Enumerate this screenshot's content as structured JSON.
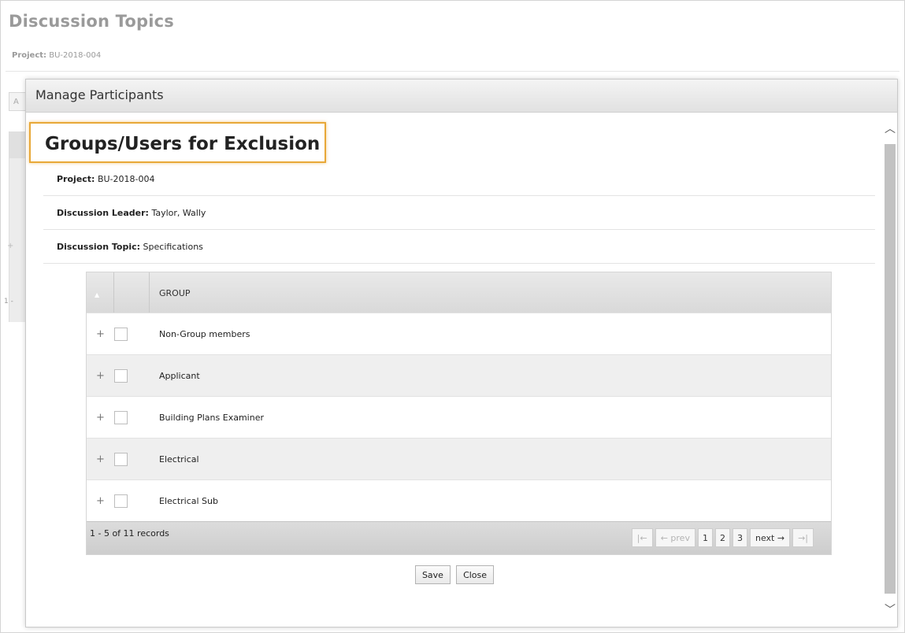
{
  "background": {
    "title": "Discussion Topics",
    "project_label": "Project:",
    "project_value": "BU-2018-004",
    "stub_text": "1 -",
    "close_label": "×"
  },
  "modal": {
    "title": "Manage Participants",
    "section_title": "Groups/Users for Exclusion",
    "info": [
      {
        "label": "Project:",
        "value": "BU-2018-004"
      },
      {
        "label": "Discussion Leader:",
        "value": "Taylor, Wally"
      },
      {
        "label": "Discussion Topic:",
        "value": "Specifications"
      }
    ],
    "grid": {
      "column_header": "GROUP",
      "rows": [
        {
          "expand": "+",
          "name": "Non-Group members"
        },
        {
          "expand": "+",
          "name": "Applicant"
        },
        {
          "expand": "+",
          "name": "Building Plans Examiner"
        },
        {
          "expand": "+",
          "name": "Electrical"
        },
        {
          "expand": "+",
          "name": "Electrical Sub"
        }
      ],
      "records_text": "1 - 5 of 11 records",
      "pager": {
        "first": "|←",
        "prev": "← prev",
        "pages": [
          "1",
          "2",
          "3"
        ],
        "next": "next →",
        "last": "→|"
      }
    },
    "buttons": {
      "save": "Save",
      "close": "Close"
    }
  },
  "icons": {
    "scroll_up": "chevron-up-icon",
    "scroll_down": "chevron-down-icon"
  },
  "colors": {
    "highlight": "#e8a838"
  }
}
